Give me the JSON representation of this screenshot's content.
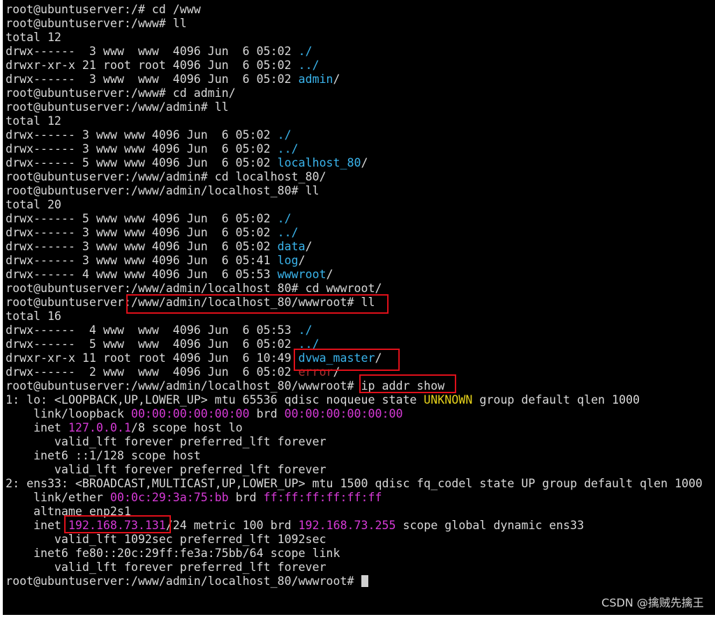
{
  "terminal": {
    "watermark": "CSDN @擒贼先擒王",
    "colors": {
      "background": "#000000",
      "text": "#d9d9d9",
      "directory": "#3ab4ec",
      "address": "#d63ad6",
      "state": "#e6d21a",
      "highlight_box": "#e0101a"
    },
    "lines": [
      [
        {
          "t": "root@ubuntuserver:/# cd /www"
        }
      ],
      [
        {
          "t": "root@ubuntuserver:/www# ll"
        }
      ],
      [
        {
          "t": "total 12"
        }
      ],
      [
        {
          "t": "drwx------  3 www  www  4096 Jun  6 05:02 "
        },
        {
          "t": "./",
          "c": "dir"
        }
      ],
      [
        {
          "t": "drwxr-xr-x 21 root root 4096 Jun  6 05:02 "
        },
        {
          "t": "../",
          "c": "dir"
        }
      ],
      [
        {
          "t": "drwx------  3 www  www  4096 Jun  6 05:02 "
        },
        {
          "t": "admin",
          "c": "dir"
        },
        {
          "t": "/"
        }
      ],
      [
        {
          "t": "root@ubuntuserver:/www# cd admin/"
        }
      ],
      [
        {
          "t": "root@ubuntuserver:/www/admin# ll"
        }
      ],
      [
        {
          "t": "total 12"
        }
      ],
      [
        {
          "t": "drwx------ 3 www www 4096 Jun  6 05:02 "
        },
        {
          "t": "./",
          "c": "dir"
        }
      ],
      [
        {
          "t": "drwx------ 3 www www 4096 Jun  6 05:02 "
        },
        {
          "t": "../",
          "c": "dir"
        }
      ],
      [
        {
          "t": "drwx------ 5 www www 4096 Jun  6 05:02 "
        },
        {
          "t": "localhost_80",
          "c": "dir"
        },
        {
          "t": "/"
        }
      ],
      [
        {
          "t": "root@ubuntuserver:/www/admin# cd localhost_80/"
        }
      ],
      [
        {
          "t": "root@ubuntuserver:/www/admin/localhost_80# ll"
        }
      ],
      [
        {
          "t": "total 20"
        }
      ],
      [
        {
          "t": "drwx------ 5 www www 4096 Jun  6 05:02 "
        },
        {
          "t": "./",
          "c": "dir"
        }
      ],
      [
        {
          "t": "drwx------ 3 www www 4096 Jun  6 05:02 "
        },
        {
          "t": "../",
          "c": "dir"
        }
      ],
      [
        {
          "t": "drwx------ 3 www www 4096 Jun  6 05:02 "
        },
        {
          "t": "data",
          "c": "dir"
        },
        {
          "t": "/"
        }
      ],
      [
        {
          "t": "drwx------ 3 www www 4096 Jun  6 05:41 "
        },
        {
          "t": "log",
          "c": "dir"
        },
        {
          "t": "/"
        }
      ],
      [
        {
          "t": "drwx------ 4 www www 4096 Jun  6 05:53 "
        },
        {
          "t": "wwwroot",
          "c": "dir"
        },
        {
          "t": "/"
        }
      ],
      [
        {
          "t": "root@ubuntuserver:/www/admin/localhost_80# cd wwwroot/"
        }
      ],
      [
        {
          "t": "root@ubuntuserver:/www/admin/localhost_80/wwwroot# ll"
        }
      ],
      [
        {
          "t": "total 16"
        }
      ],
      [
        {
          "t": "drwx------  4 www  www  4096 Jun  6 05:53 "
        },
        {
          "t": "./",
          "c": "dir"
        }
      ],
      [
        {
          "t": "drwx------  5 www  www  4096 Jun  6 05:02 "
        },
        {
          "t": "../",
          "c": "dir"
        }
      ],
      [
        {
          "t": "drwxr-xr-x 11 root root 4096 Jun  6 10:49 "
        },
        {
          "t": "dvwa_master",
          "c": "dir"
        },
        {
          "t": "/"
        }
      ],
      [
        {
          "t": "drwx------  2 www  www  4096 Jun  6 05:02 "
        },
        {
          "t": "error",
          "c": "red"
        },
        {
          "t": "/"
        }
      ],
      [
        {
          "t": "root@ubuntuserver:/www/admin/localhost_80/wwwroot# ip addr show"
        }
      ],
      [
        {
          "t": "1: lo: <LOOPBACK,UP,LOWER_UP> mtu 65536 qdisc noqueue state "
        },
        {
          "t": "UNKNOWN",
          "c": "yel"
        },
        {
          "t": " group default qlen 1000"
        }
      ],
      [
        {
          "t": "    link/loopback "
        },
        {
          "t": "00:00:00:00:00:00",
          "c": "mag"
        },
        {
          "t": " brd "
        },
        {
          "t": "00:00:00:00:00:00",
          "c": "mag"
        }
      ],
      [
        {
          "t": "    inet "
        },
        {
          "t": "127.0.0.1",
          "c": "mag"
        },
        {
          "t": "/8 scope host lo"
        }
      ],
      [
        {
          "t": "       valid_lft forever preferred_lft forever"
        }
      ],
      [
        {
          "t": "    inet6 ::1/128 scope host"
        }
      ],
      [
        {
          "t": "       valid_lft forever preferred_lft forever"
        }
      ],
      [
        {
          "t": "2: ens33: <BROADCAST,MULTICAST,UP,LOWER_UP> mtu 1500 qdisc fq_codel state UP group default qlen 1000"
        }
      ],
      [
        {
          "t": "    link/ether "
        },
        {
          "t": "00:0c:29:3a:75:bb",
          "c": "mag"
        },
        {
          "t": " brd "
        },
        {
          "t": "ff:ff:ff:ff:ff:ff",
          "c": "mag"
        }
      ],
      [
        {
          "t": "    altname enp2s1"
        }
      ],
      [
        {
          "t": "    inet "
        },
        {
          "t": "192.168.73.131",
          "c": "mag"
        },
        {
          "t": "/24 metric 100 brd "
        },
        {
          "t": "192.168.73.255",
          "c": "mag"
        },
        {
          "t": " scope global dynamic ens33"
        }
      ],
      [
        {
          "t": "       valid_lft 1092sec preferred_lft 1092sec"
        }
      ],
      [
        {
          "t": "    inet6 fe80::20c:29ff:fe3a:75bb/64 scope link"
        }
      ],
      [
        {
          "t": "       valid_lft forever preferred_lft forever"
        }
      ],
      [
        {
          "t": "root@ubuntuserver:/www/admin/localhost_80/wwwroot# "
        },
        {
          "cursor": true
        }
      ]
    ]
  }
}
